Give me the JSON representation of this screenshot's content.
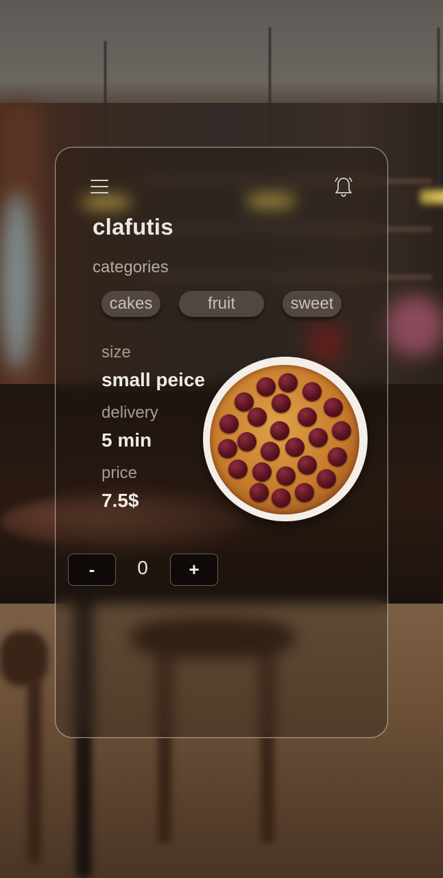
{
  "product": {
    "name": "clafutis",
    "categories_label": "categories",
    "categories": [
      "cakes",
      "fruit",
      "sweet"
    ]
  },
  "details": {
    "size_label": "size",
    "size_value": "small peice",
    "delivery_label": "delivery",
    "delivery_value": "5 min",
    "price_label": "price",
    "price_value": "7.5$"
  },
  "quantity": {
    "minus_label": "-",
    "value": "0",
    "plus_label": "+"
  },
  "icons": {
    "menu": "hamburger-menu-icon",
    "notifications": "bell-icon"
  },
  "colors": {
    "card_border": "#ffffff",
    "chip_bg": "#5f554e",
    "button_bg": "#0c0806",
    "text_primary": "#efebe6",
    "text_secondary": "#a59d93"
  }
}
